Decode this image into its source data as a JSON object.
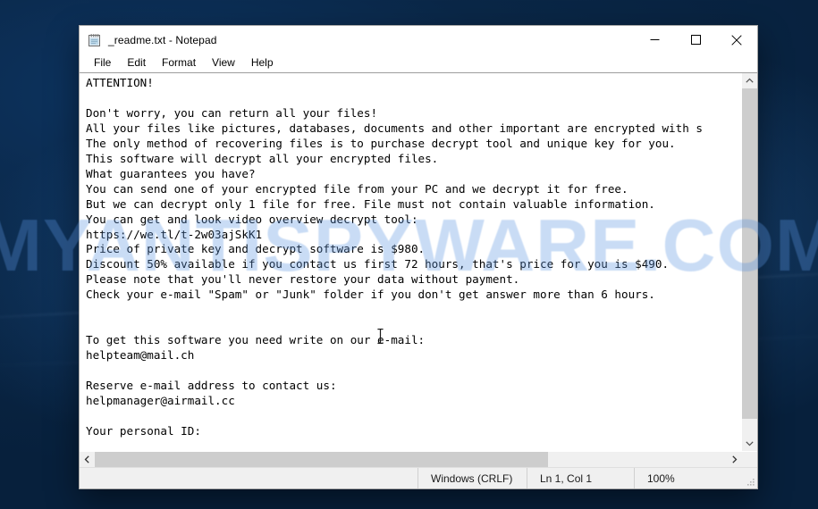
{
  "desktop": {
    "watermark_text": "MYANTISPYWARE.COM",
    "background_color": "#0a2a4d"
  },
  "window": {
    "title": "_readme.txt - Notepad",
    "icon": "notepad-icon",
    "controls": {
      "minimize_label": "Minimize",
      "maximize_label": "Maximize",
      "close_label": "Close"
    },
    "menu": [
      {
        "label": "File"
      },
      {
        "label": "Edit"
      },
      {
        "label": "Format"
      },
      {
        "label": "View"
      },
      {
        "label": "Help"
      }
    ]
  },
  "editor": {
    "document_name": "_readme.txt",
    "text": "ATTENTION!\n\nDon't worry, you can return all your files!\nAll your files like pictures, databases, documents and other important are encrypted with s\nThe only method of recovering files is to purchase decrypt tool and unique key for you.\nThis software will decrypt all your encrypted files.\nWhat guarantees you have?\nYou can send one of your encrypted file from your PC and we decrypt it for free.\nBut we can decrypt only 1 file for free. File must not contain valuable information.\nYou can get and look video overview decrypt tool:\nhttps://we.tl/t-2w03ajSkK1\nPrice of private key and decrypt software is $980.\nDiscount 50% available if you contact us first 72 hours, that's price for you is $490.\nPlease note that you'll never restore your data without payment.\nCheck your e-mail \"Spam\" or \"Junk\" folder if you don't get answer more than 6 hours.\n\n\nTo get this software you need write on our e-mail:\nhelpteam@mail.ch\n\nReserve e-mail address to contact us:\nhelpmanager@airmail.cc\n\nYour personal ID:",
    "video_url": "https://we.tl/t-2w03ajSkK1",
    "price_full": "$980",
    "price_discount": "$490",
    "discount_percent": "50%",
    "discount_window_hours": "72",
    "response_time_hours": "6",
    "email_primary": "helpteam@mail.ch",
    "email_reserve": "helpmanager@airmail.cc"
  },
  "scrollbars": {
    "vertical": {
      "up_icon": "chevron-up-icon",
      "down_icon": "chevron-down-icon"
    },
    "horizontal": {
      "left_icon": "chevron-left-icon",
      "right_icon": "chevron-right-icon"
    }
  },
  "statusbar": {
    "line_ending": "Windows (CRLF)",
    "cursor_position": "Ln 1, Col 1",
    "zoom": "100%"
  }
}
